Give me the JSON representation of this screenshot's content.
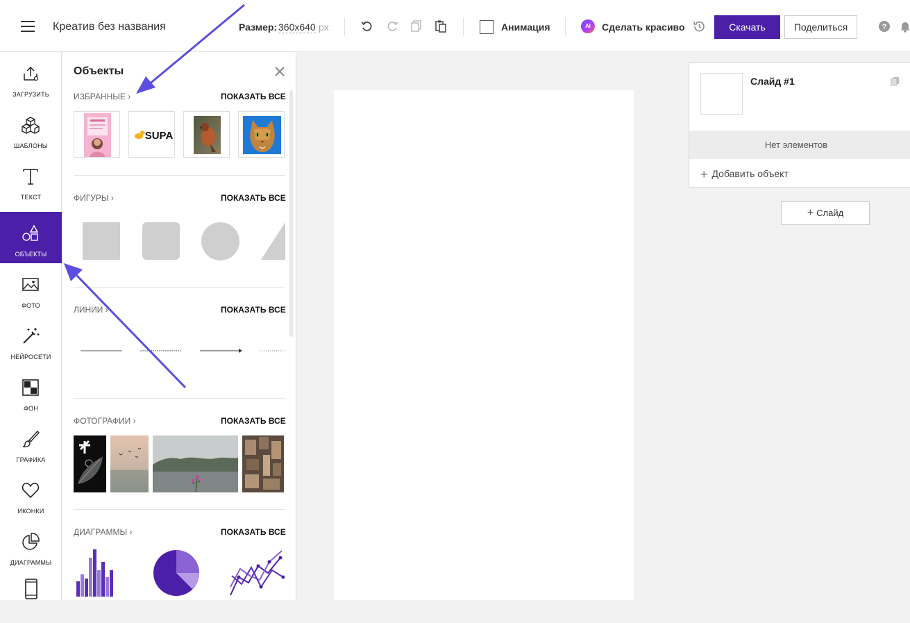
{
  "header": {
    "title": "Креатив без названия",
    "size_label": "Размер:",
    "size_value": "360x640",
    "size_unit": "px",
    "animation_label": "Анимация",
    "ai_badge": "AI",
    "beautify_label": "Сделать красиво",
    "download_label": "Скачать",
    "share_label": "Поделиться"
  },
  "sidebar": {
    "items": [
      {
        "label": "ЗАГРУЗИТЬ",
        "icon": "upload-icon"
      },
      {
        "label": "ШАБЛОНЫ",
        "icon": "cubes-icon"
      },
      {
        "label": "ТЕКСТ",
        "icon": "text-icon"
      },
      {
        "label": "ОБЪЕКТЫ",
        "icon": "shapes-icon",
        "active": true
      },
      {
        "label": "ФОТО",
        "icon": "image-icon"
      },
      {
        "label": "НЕЙРОСЕТИ",
        "icon": "magic-wand-icon"
      },
      {
        "label": "ФОН",
        "icon": "background-icon"
      },
      {
        "label": "ГРАФИКА",
        "icon": "brush-icon"
      },
      {
        "label": "ИКОНКИ",
        "icon": "heart-icon"
      },
      {
        "label": "ДИАГРАММЫ",
        "icon": "pie-chart-icon"
      },
      {
        "label": "",
        "icon": "phone-icon"
      }
    ]
  },
  "panel": {
    "title": "Объекты",
    "show_all": "ПОКАЗАТЬ ВСЕ",
    "sections": {
      "favorites": "ИЗБРАННЫЕ",
      "shapes": "ФИГУРЫ",
      "lines": "ЛИНИИ",
      "photos": "ФОТОГРАФИИ",
      "charts": "ДИАГРАММЫ"
    },
    "favorite_logo_text": "SUPA"
  },
  "slides": {
    "slide_name": "Слайд #1",
    "empty_text": "Нет элементов",
    "add_object": "Добавить объект",
    "add_slide": "Слайд"
  },
  "colors": {
    "accent": "#4b1fa8",
    "annotation_arrow": "#5b4ee0"
  }
}
